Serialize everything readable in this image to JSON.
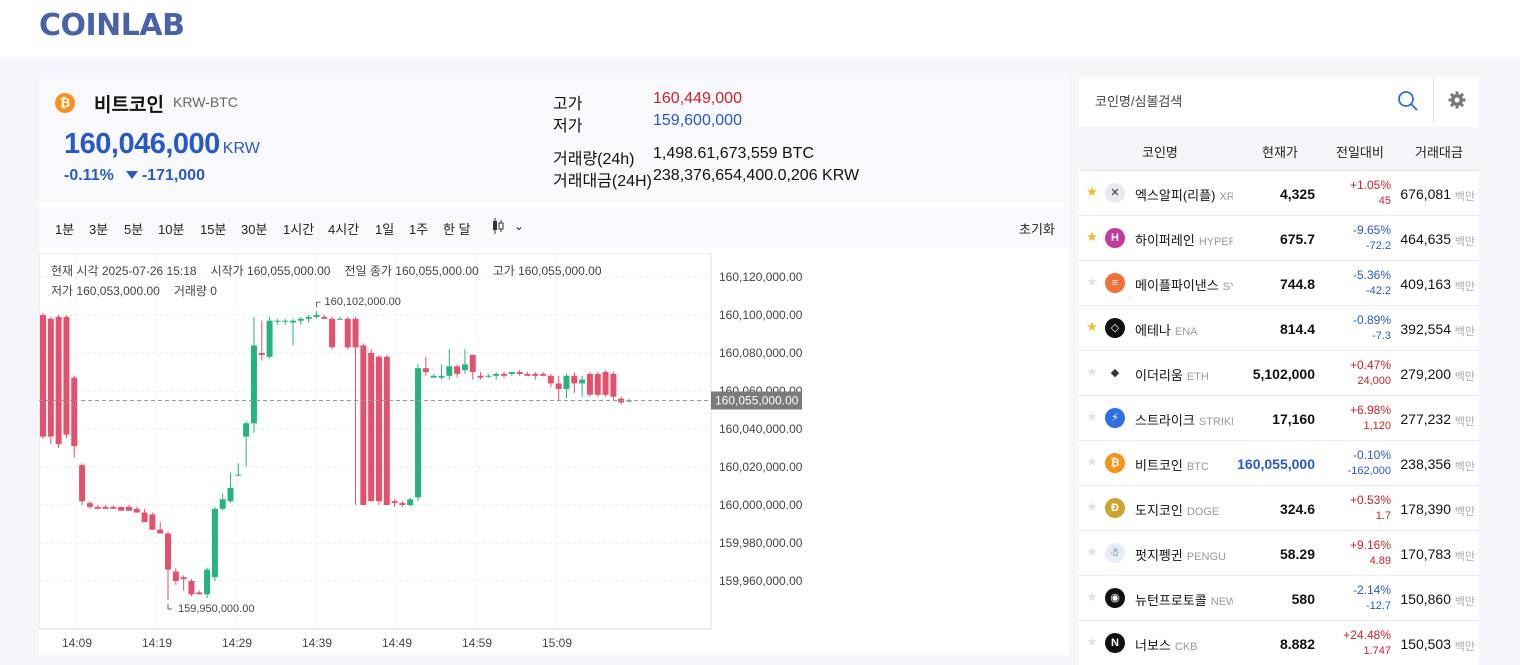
{
  "app": {
    "logo": "COINLAB"
  },
  "coin": {
    "icon": "bitcoin-icon",
    "icon_color": "#f7931a",
    "name": "비트코인",
    "pair": "KRW-BTC",
    "price": "160,046,000",
    "unit": "KRW",
    "change_pct": "-0.11%",
    "change_abs": "-171,000",
    "direction": "down",
    "stats": {
      "high_label": "고가",
      "high": "160,449,000",
      "low_label": "저가",
      "low": "159,600,000",
      "volume_label": "거래량(24h)",
      "volume": "1,498.61,673,559 BTC",
      "amount_label": "거래대금(24H)",
      "amount": "238,376,654,400.0,206 KRW"
    }
  },
  "intervals": [
    "1분",
    "3분",
    "5분",
    "10분",
    "15분",
    "30분",
    "1시간",
    "4시간",
    "1일",
    "1주",
    "한 달"
  ],
  "reset_label": "초기화",
  "legend": {
    "time": "현재 시각 2025-07-26 15:18",
    "open": "시작가 160,055,000.00",
    "prev_close": "전일 종가 160,055,000.00",
    "high": "고가 160,055,000.00",
    "low": "저가 160,053,000.00",
    "volume": "거래량 0"
  },
  "chart_data": {
    "type": "candlestick",
    "ylim": [
      159935000,
      160130000
    ],
    "y_ticks": [
      "160,120,000.00",
      "160,100,000.00",
      "160,080,000.00",
      "160,060,000.00",
      "160,040,000.00",
      "160,020,000.00",
      "160,000,000.00",
      "159,980,000.00",
      "159,960,000.00"
    ],
    "y_tick_values": [
      160120000,
      160100000,
      160080000,
      160060000,
      160040000,
      160020000,
      160000000,
      159980000,
      159960000
    ],
    "x_ticks": [
      "14:09",
      "14:19",
      "14:29",
      "14:39",
      "14:49",
      "14:59",
      "15:09"
    ],
    "x_tick_index": [
      3,
      13,
      23,
      33,
      43,
      53,
      63
    ],
    "current_price": 160055000,
    "current_price_label": "160,055,000.00",
    "max_label": "160,102,000.00",
    "max_value": 160102000,
    "min_label": "159,950,000.00",
    "min_value": 159950000,
    "up_color": "#26b47e",
    "down_color": "#e5506d",
    "candles": [
      [
        160100000,
        160101000,
        160035000,
        160036000
      ],
      [
        160098000,
        160099000,
        160032000,
        160036000
      ],
      [
        160099000,
        160100000,
        160030000,
        160032000
      ],
      [
        160099000,
        160100000,
        160035000,
        160037000
      ],
      [
        160067000,
        160068000,
        160025000,
        160031000
      ],
      [
        160021000,
        160022000,
        160000000,
        160002000
      ],
      [
        160001000,
        160002000,
        159998000,
        159999000
      ],
      [
        159999000,
        160000000,
        159998000,
        159998000
      ],
      [
        159999000,
        160000000,
        159998000,
        159998000
      ],
      [
        159999000,
        160000000,
        159998000,
        159998000
      ],
      [
        159999000,
        159999000,
        159997000,
        159997000
      ],
      [
        159999000,
        160000000,
        159997000,
        159997000
      ],
      [
        159998000,
        159999000,
        159996000,
        159996000
      ],
      [
        159996000,
        159998000,
        159991000,
        159991000
      ],
      [
        159995000,
        159996000,
        159987000,
        159987000
      ],
      [
        159987000,
        159991000,
        159985000,
        159985000
      ],
      [
        159985000,
        159986000,
        159950000,
        159966000
      ],
      [
        159965000,
        159967000,
        159958000,
        159960000
      ],
      [
        159962000,
        159963000,
        159955000,
        159961000
      ],
      [
        159960000,
        159961000,
        159952000,
        159953000
      ],
      [
        159954000,
        159955000,
        159953000,
        159953000
      ],
      [
        159953000,
        159967000,
        159951000,
        159966000
      ],
      [
        159962000,
        159999000,
        159960000,
        159998000
      ],
      [
        159998000,
        160006000,
        159997000,
        160003000
      ],
      [
        160002000,
        160017000,
        160001000,
        160009000
      ],
      [
        160016000,
        160022000,
        160015000,
        160016000
      ],
      [
        160036000,
        160044000,
        160020000,
        160043000
      ],
      [
        160043000,
        160099000,
        160038000,
        160084000
      ],
      [
        160080000,
        160097000,
        160076000,
        160079000
      ],
      [
        160078000,
        160099000,
        160077000,
        160097000
      ],
      [
        160097000,
        160098000,
        160095000,
        160097000
      ],
      [
        160097000,
        160098000,
        160095000,
        160097000
      ],
      [
        160096000,
        160098000,
        160084000,
        160097000
      ],
      [
        160097000,
        160099000,
        160095000,
        160098000
      ],
      [
        160098000,
        160100000,
        160096000,
        160099000
      ],
      [
        160099000,
        160102000,
        160098000,
        160100000
      ],
      [
        160099000,
        160100000,
        160098000,
        160098000
      ],
      [
        160098000,
        160099000,
        160082000,
        160083000
      ],
      [
        160098000,
        160099000,
        160098000,
        160098000
      ],
      [
        160098000,
        160099000,
        160082000,
        160083000
      ],
      [
        160098000,
        160099000,
        160000000,
        160083000
      ],
      [
        160084000,
        160085000,
        160000000,
        160000000
      ],
      [
        160080000,
        160082000,
        160010000,
        160002000
      ],
      [
        160078000,
        160079000,
        160000000,
        160002000
      ],
      [
        160078000,
        160079000,
        160000000,
        160000000
      ],
      [
        160002000,
        160003000,
        159999000,
        160001000
      ],
      [
        160001000,
        160002000,
        159999000,
        160000000
      ],
      [
        160000000,
        160004000,
        159999000,
        160003000
      ],
      [
        160004000,
        160074000,
        160002000,
        160072000
      ],
      [
        160072000,
        160078000,
        160068000,
        160070000
      ],
      [
        160067000,
        160069000,
        160067000,
        160068000
      ],
      [
        160067000,
        160074000,
        160066000,
        160068000
      ],
      [
        160068000,
        160082000,
        160066000,
        160073000
      ],
      [
        160073000,
        160074000,
        160067000,
        160069000
      ],
      [
        160071000,
        160082000,
        160069000,
        160074000
      ],
      [
        160079000,
        160079000,
        160066000,
        160070000
      ],
      [
        160068000,
        160070000,
        160066000,
        160067000
      ],
      [
        160068000,
        160069000,
        160067000,
        160068000
      ],
      [
        160068000,
        160070000,
        160066000,
        160069000
      ],
      [
        160069000,
        160070000,
        160067000,
        160068000
      ],
      [
        160069000,
        160070000,
        160068000,
        160070000
      ],
      [
        160070000,
        160071000,
        160068000,
        160069000
      ],
      [
        160069000,
        160070000,
        160068000,
        160068000
      ],
      [
        160069000,
        160070000,
        160066000,
        160068000
      ],
      [
        160069000,
        160070000,
        160068000,
        160068000
      ],
      [
        160068000,
        160069000,
        160062000,
        160064000
      ],
      [
        160064000,
        160068000,
        160055000,
        160061000
      ],
      [
        160061000,
        160069000,
        160056000,
        160068000
      ],
      [
        160068000,
        160070000,
        160059000,
        160064000
      ],
      [
        160064000,
        160068000,
        160057000,
        160066000
      ],
      [
        160069000,
        160070000,
        160057000,
        160058000
      ],
      [
        160069000,
        160070000,
        160057000,
        160058000
      ],
      [
        160070000,
        160071000,
        160057000,
        160058000
      ],
      [
        160069000,
        160070000,
        160055000,
        160057000
      ],
      [
        160056000,
        160057000,
        160053000,
        160054000
      ],
      [
        160055000,
        160056000,
        160054000,
        160055000
      ]
    ]
  },
  "search": {
    "placeholder": "코인명/심볼검색"
  },
  "table": {
    "headers": [
      "코인명",
      "현재가",
      "전일대비",
      "거래대금"
    ],
    "rows": [
      {
        "fav": true,
        "icon": "xrp-icon",
        "icon_bg": "#e8eaee",
        "glyph": "✕",
        "name": "엑스알피(리플)",
        "symbol": "XRP",
        "price": "4,325",
        "pct": "+1.05%",
        "abs": "45",
        "vol": "676,081",
        "unit": "백만"
      },
      {
        "fav": true,
        "icon": "hyperliquid-icon",
        "icon_bg": "#c23a9e",
        "glyph": "H",
        "name": "하이퍼레인",
        "symbol": "HYPER",
        "price": "675.7",
        "pct": "-9.65%",
        "abs": "-72.2",
        "vol": "464,635",
        "unit": "백만"
      },
      {
        "fav": false,
        "icon": "maple-icon",
        "icon_bg": "#f2713a",
        "glyph": "≡",
        "name": "메이플파이낸스",
        "symbol": "SYRUP",
        "price": "744.8",
        "pct": "-5.36%",
        "abs": "-42.2",
        "vol": "409,163",
        "unit": "백만"
      },
      {
        "fav": true,
        "icon": "ethena-icon",
        "icon_bg": "#111111",
        "glyph": "◇",
        "name": "에테나",
        "symbol": "ENA",
        "price": "814.4",
        "pct": "-0.89%",
        "abs": "-7.3",
        "vol": "392,554",
        "unit": "백만"
      },
      {
        "fav": false,
        "icon": "ethereum-icon",
        "icon_bg": "#ffffff",
        "glyph": "◆",
        "name": "이더리움",
        "symbol": "ETH",
        "price": "5,102,000",
        "pct": "+0.47%",
        "abs": "24,000",
        "vol": "279,200",
        "unit": "백만"
      },
      {
        "fav": false,
        "icon": "strike-icon",
        "icon_bg": "#2f6fdf",
        "glyph": "⚡",
        "name": "스트라이크",
        "symbol": "STRIKE",
        "price": "17,160",
        "pct": "+6.98%",
        "abs": "1,120",
        "vol": "277,232",
        "unit": "백만"
      },
      {
        "fav": false,
        "icon": "bitcoin-icon",
        "icon_bg": "#f7931a",
        "glyph": "₿",
        "name": "비트코인",
        "symbol": "BTC",
        "price": "160,055,000",
        "pct": "-0.10%",
        "abs": "-162,000",
        "vol": "238,356",
        "unit": "백만"
      },
      {
        "fav": false,
        "icon": "dogecoin-icon",
        "icon_bg": "#c9a632",
        "glyph": "Ð",
        "name": "도지코인",
        "symbol": "DOGE",
        "price": "324.6",
        "pct": "+0.53%",
        "abs": "1.7",
        "vol": "178,390",
        "unit": "백만"
      },
      {
        "fav": false,
        "icon": "pengu-icon",
        "icon_bg": "#e6eef8",
        "glyph": "☃",
        "name": "펏지펭귄",
        "symbol": "PENGU",
        "price": "58.29",
        "pct": "+9.16%",
        "abs": "4.89",
        "vol": "170,783",
        "unit": "백만"
      },
      {
        "fav": false,
        "icon": "neutron-icon",
        "icon_bg": "#111111",
        "glyph": "◉",
        "name": "뉴턴프로토콜",
        "symbol": "NEWT",
        "price": "580",
        "pct": "-2.14%",
        "abs": "-12.7",
        "vol": "150,860",
        "unit": "백만"
      },
      {
        "fav": false,
        "icon": "nervos-icon",
        "icon_bg": "#111111",
        "glyph": "N",
        "name": "너보스",
        "symbol": "CKB",
        "price": "8.882",
        "pct": "+24.48%",
        "abs": "1.747",
        "vol": "150,503",
        "unit": "백만"
      }
    ]
  }
}
